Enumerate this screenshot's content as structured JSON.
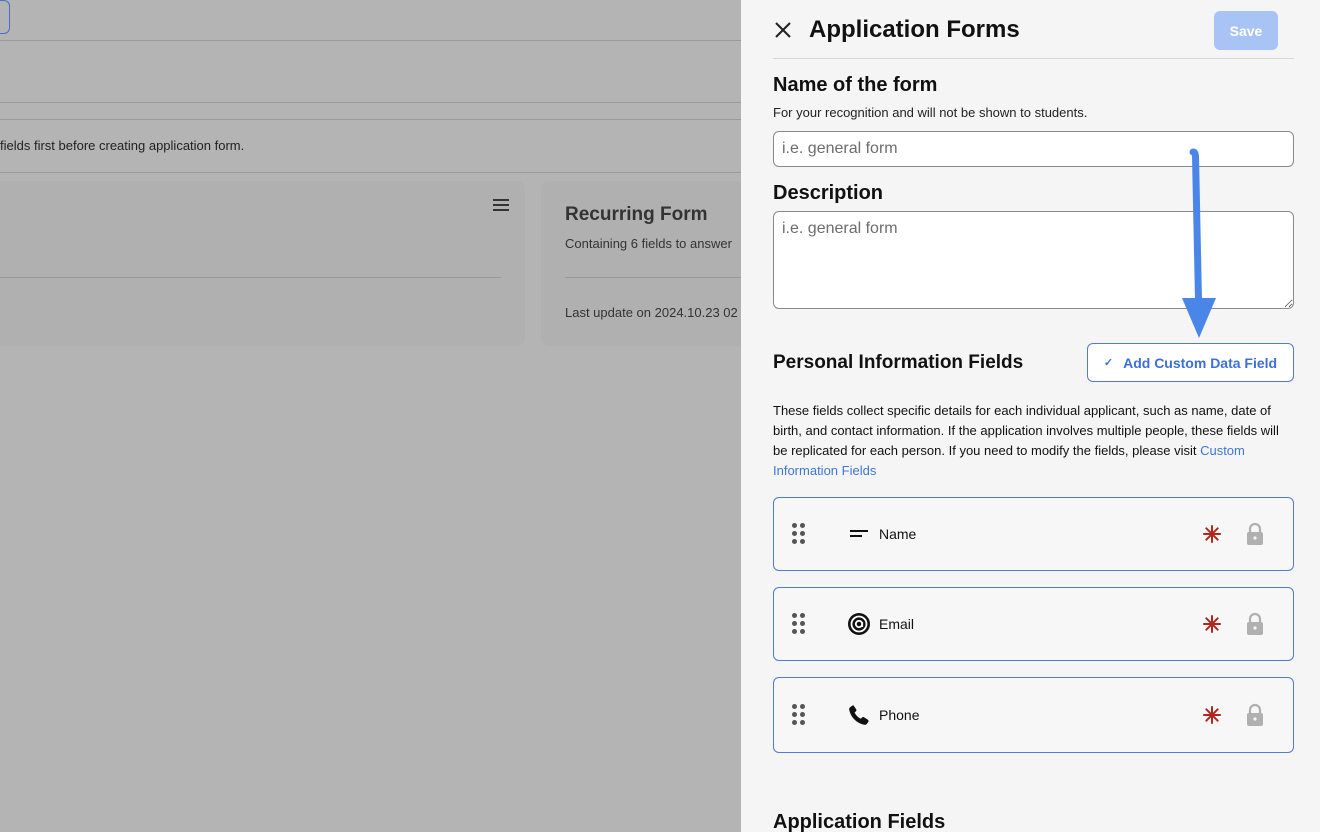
{
  "background": {
    "notice": "fields first before creating application form.",
    "card": {
      "title": "Recurring Form",
      "subtitle": "Containing 6 fields to answer",
      "last_update": "Last update on 2024.10.23 02"
    }
  },
  "drawer": {
    "title": "Application Forms",
    "save_label": "Save",
    "name_section": {
      "heading": "Name of the form",
      "help": "For your recognition and will not be shown to students.",
      "placeholder": "i.e. general form",
      "value": ""
    },
    "description_section": {
      "heading": "Description",
      "placeholder": "i.e. general form",
      "value": ""
    },
    "personal_info": {
      "heading": "Personal Information Fields",
      "add_button_label": "Add Custom Data Field",
      "add_button_check": "✓",
      "description_text": "These fields collect specific details for each individual applicant, such as name, date of birth, and contact information. If the application involves multiple people, these fields will be replicated for each person. If you need to modify the fields, please visit ",
      "description_link": "Custom Information Fields",
      "fields": [
        {
          "label": "Name",
          "icon": "text-lines-icon",
          "required": true,
          "locked": true
        },
        {
          "label": "Email",
          "icon": "at-sign-icon",
          "required": true,
          "locked": true
        },
        {
          "label": "Phone",
          "icon": "phone-icon",
          "required": true,
          "locked": true
        }
      ]
    },
    "application_fields": {
      "heading": "Application Fields"
    }
  },
  "colors": {
    "accent": "#4e7ad8",
    "save_disabled": "#a8c4f5",
    "required": "#b3261e",
    "annotation_arrow": "#4a86e8",
    "overlay": "#b4b4b4"
  }
}
